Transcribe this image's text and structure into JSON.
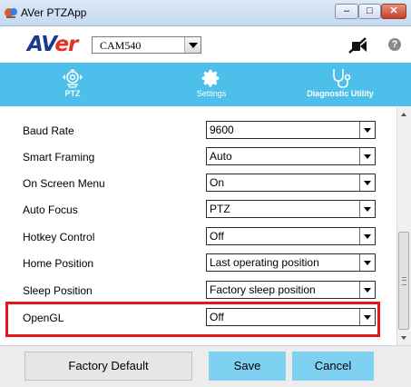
{
  "window": {
    "title": "AVer PTZApp",
    "minimize": "–",
    "maximize": "□",
    "close": "✕"
  },
  "header": {
    "logo_main": "AV",
    "logo_accent": "er",
    "camera_select": "CAM540",
    "mute_icon": "microphone-off-icon",
    "help_label": "?"
  },
  "tabs": [
    {
      "label": "PTZ",
      "icon": "ptz-camera-icon"
    },
    {
      "label": "Settings",
      "icon": "gear-icon"
    },
    {
      "label": "Diagnostic Utility",
      "icon": "stethoscope-icon"
    }
  ],
  "settings": [
    {
      "label": "Baud Rate",
      "value": "9600"
    },
    {
      "label": "Smart Framing",
      "value": "Auto"
    },
    {
      "label": "On Screen Menu",
      "value": "On"
    },
    {
      "label": "Auto Focus",
      "value": "PTZ"
    },
    {
      "label": "Hotkey Control",
      "value": "Off"
    },
    {
      "label": "Home Position",
      "value": "Last operating position"
    },
    {
      "label": "Sleep Position",
      "value": "Factory sleep position"
    },
    {
      "label": "OpenGL",
      "value": "Off"
    }
  ],
  "buttons": {
    "factory_default": "Factory Default",
    "save": "Save",
    "cancel": "Cancel"
  },
  "colors": {
    "accent": "#4cbfea",
    "button": "#7fd1f2",
    "highlight": "#e5141d",
    "logo": "#1a3a8f",
    "logo_accent": "#e6321e"
  }
}
